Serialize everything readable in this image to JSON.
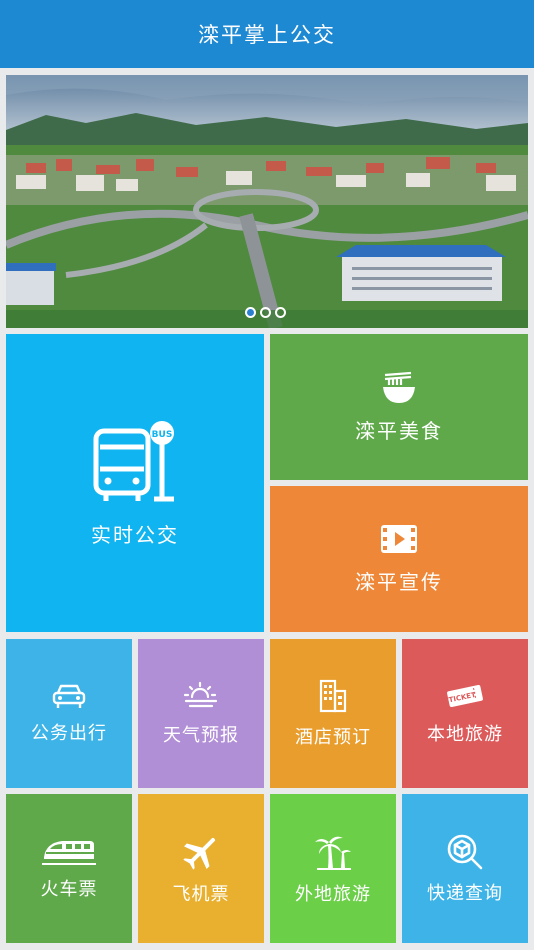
{
  "header": {
    "title": "滦平掌上公交"
  },
  "banner": {
    "slides": 3,
    "active_index": 0
  },
  "tiles": {
    "realtime_bus": {
      "label": "实时公交",
      "icon": "bus-stop-icon",
      "color": "#0fb4f0"
    },
    "food": {
      "label": "滦平美食",
      "icon": "noodle-bowl-icon",
      "color": "#5fa94b"
    },
    "promo": {
      "label": "滦平宣传",
      "icon": "film-play-icon",
      "color": "#ee8838"
    },
    "official_travel": {
      "label": "公务出行",
      "icon": "car-icon",
      "color": "#3db3e8"
    },
    "weather": {
      "label": "天气预报",
      "icon": "weather-sun-cloud-icon",
      "color": "#b18fd6"
    },
    "hotel": {
      "label": "酒店预订",
      "icon": "building-icon",
      "color": "#e99d2c"
    },
    "local_tour": {
      "label": "本地旅游",
      "icon": "ticket-icon",
      "color": "#dd5a5b"
    },
    "train": {
      "label": "火车票",
      "icon": "train-icon",
      "color": "#5fa94b"
    },
    "flight": {
      "label": "飞机票",
      "icon": "airplane-icon",
      "color": "#e8b02e"
    },
    "outer_tour": {
      "label": "外地旅游",
      "icon": "palm-tree-icon",
      "color": "#6bcf48"
    },
    "express": {
      "label": "快递查询",
      "icon": "package-search-icon",
      "color": "#3db3e8"
    }
  }
}
